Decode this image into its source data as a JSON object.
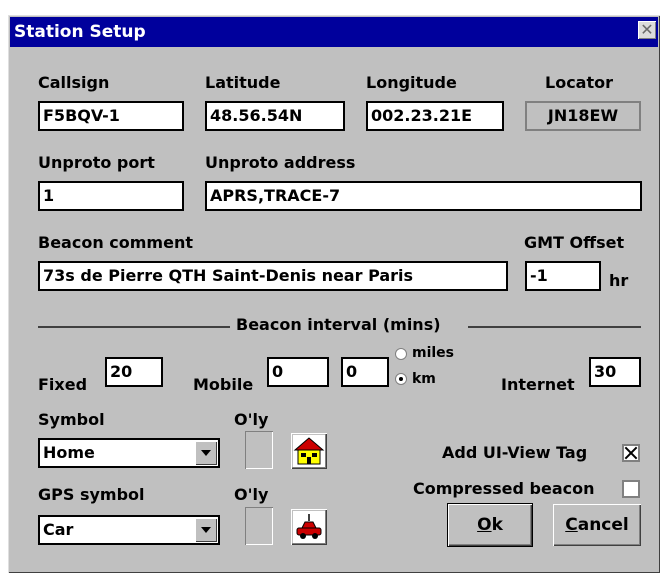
{
  "window": {
    "title": "Station Setup",
    "close_glyph": "✕"
  },
  "callsign": {
    "label": "Callsign",
    "value": "F5BQV-1"
  },
  "latitude": {
    "label": "Latitude",
    "value": "48.56.54N"
  },
  "longitude": {
    "label": "Longitude",
    "value": "002.23.21E"
  },
  "locator": {
    "label": "Locator",
    "value": "JN18EW"
  },
  "unproto_port": {
    "label": "Unproto port",
    "value": "1"
  },
  "unproto_address": {
    "label": "Unproto address",
    "value": "APRS,TRACE-7"
  },
  "beacon_comment": {
    "label": "Beacon comment",
    "value": "73s de Pierre QTH Saint-Denis near Paris"
  },
  "gmt_offset": {
    "label": "GMT Offset",
    "value": "-1",
    "unit": "hr"
  },
  "beacon_interval": {
    "label": "Beacon interval (mins)",
    "fixed_label": "Fixed",
    "fixed_value": "20",
    "mobile_label": "Mobile",
    "mobile_value1": "0",
    "mobile_value2": "0",
    "miles_label": "miles",
    "km_label": "km",
    "unit_selected": "km",
    "internet_label": "Internet",
    "internet_value": "30"
  },
  "symbol": {
    "label": "Symbol",
    "overlay_label": "O'ly",
    "selected": "Home",
    "icon": "house-icon"
  },
  "gps_symbol": {
    "label": "GPS symbol",
    "overlay_label": "O'ly",
    "selected": "Car",
    "icon": "car-icon"
  },
  "add_uiview_tag": {
    "label": "Add UI-View Tag",
    "checked": true
  },
  "compressed_beacon": {
    "label": "Compressed beacon",
    "checked": false
  },
  "buttons": {
    "ok_mnemonic": "O",
    "ok_rest": "k",
    "cancel_mnemonic": "C",
    "cancel_rest": "ancel"
  },
  "colors": {
    "title_bar": "#00009c",
    "dialog_face": "#c0c0c0",
    "house_roof": "#cc0000",
    "house_wall": "#ffff00",
    "car_body": "#cc0000"
  }
}
